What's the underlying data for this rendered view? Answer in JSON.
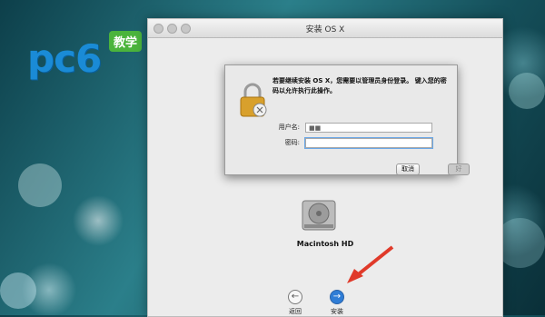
{
  "watermark": {
    "logo_text": "pc6",
    "badge": "教学"
  },
  "window": {
    "title": "安装 OS X"
  },
  "dialog": {
    "message": "若要继续安装 OS X，您需要以管理员身份登录。 键入您的密码以允许执行此操作。",
    "username_label": "用户名:",
    "username_value": "■■",
    "password_label": "密码:",
    "password_value": "",
    "cancel_label": "取消",
    "ok_label": "好"
  },
  "disk": {
    "label": "Macintosh HD"
  },
  "nav": {
    "back_label": "返回",
    "install_label": "安装"
  },
  "colors": {
    "accent": "#2f7dd6",
    "arrow": "#e03a2a",
    "logo": "#1a8bd6",
    "badge": "#4bb43c"
  }
}
